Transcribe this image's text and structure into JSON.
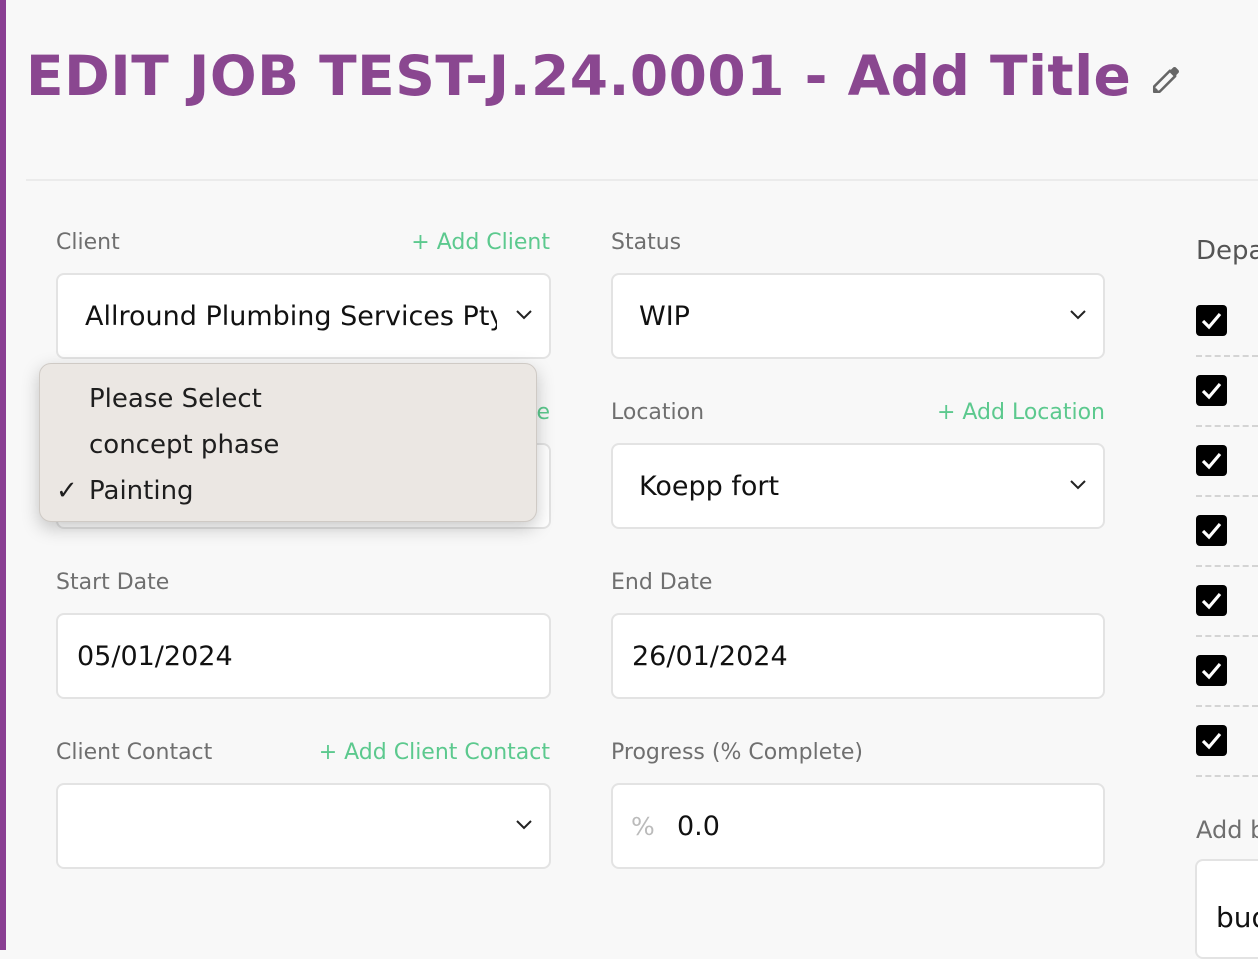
{
  "header": {
    "title": "EDIT JOB TEST-J.24.0001 - Add Title",
    "edit_icon": "pencil-icon"
  },
  "form": {
    "client": {
      "label": "Client",
      "add_link": "+ Add Client",
      "value": "Allround Plumbing Services Pty Ltd"
    },
    "status": {
      "label": "Status",
      "value": "WIP"
    },
    "stage": {
      "add_link_fragment": "e"
    },
    "location": {
      "label": "Location",
      "add_link": "+ Add Location",
      "value": "Koepp fort"
    },
    "start_date": {
      "label": "Start Date",
      "value": "05/01/2024"
    },
    "end_date": {
      "label": "End Date",
      "value": "26/01/2024"
    },
    "client_contact": {
      "label": "Client Contact",
      "add_link": "+ Add Client Contact",
      "value": ""
    },
    "progress": {
      "label": "Progress (% Complete)",
      "prefix": "%",
      "value": "0.0"
    }
  },
  "dropdown": {
    "options": [
      {
        "label": "Please Select",
        "selected": false
      },
      {
        "label": "concept phase",
        "selected": false
      },
      {
        "label": "Painting",
        "selected": true
      }
    ],
    "check_mark": "✓"
  },
  "departments": {
    "label": "Depa",
    "checked": [
      true,
      true,
      true,
      true,
      true,
      true,
      true
    ]
  },
  "budget": {
    "label": "Add b",
    "value": "bud"
  },
  "colors": {
    "accent": "#8a4790",
    "link": "#5cc98e",
    "dropdown_bg": "#ebe7e3"
  }
}
